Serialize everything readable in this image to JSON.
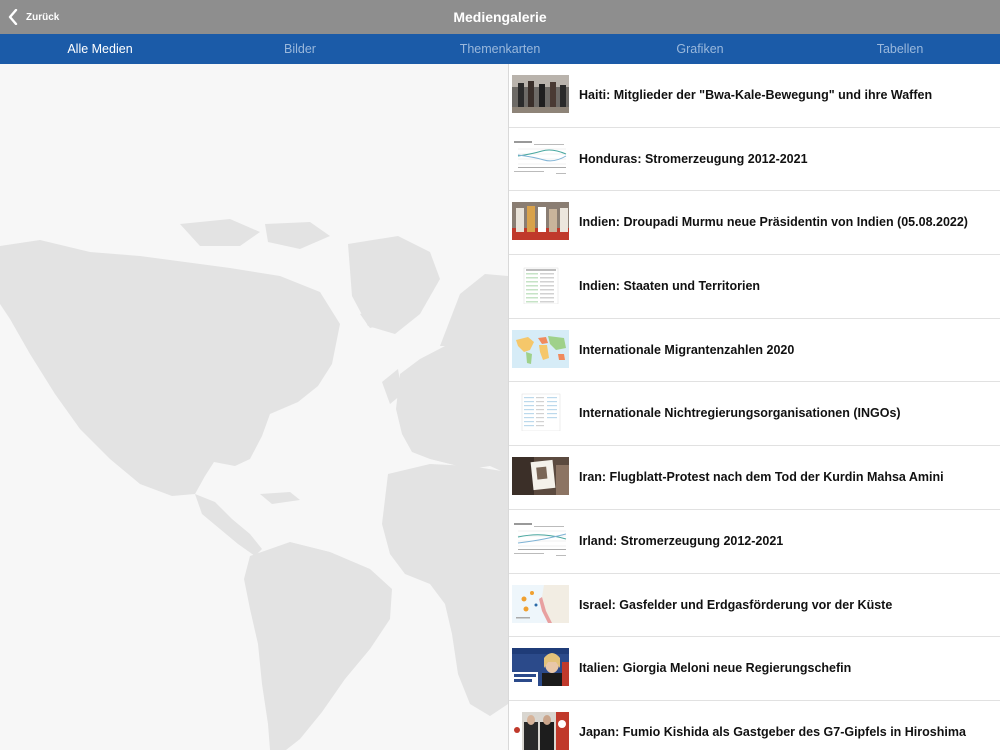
{
  "header": {
    "back_label": "Zurück",
    "title": "Mediengalerie"
  },
  "tabs": [
    {
      "label": "Alle Medien",
      "active": true
    },
    {
      "label": "Bilder",
      "active": false
    },
    {
      "label": "Themenkarten",
      "active": false
    },
    {
      "label": "Grafiken",
      "active": false
    },
    {
      "label": "Tabellen",
      "active": false
    }
  ],
  "colors": {
    "header_bg": "#8e8e8e",
    "tab_bg": "#1b5ba8",
    "tab_active": "#ffffff",
    "tab_inactive": "#9ab8dc",
    "map_land": "#e3e3e3",
    "map_bg": "#f7f7f7"
  },
  "map": {
    "icon": "world-map"
  },
  "media_items": [
    {
      "title": "Haiti: Mitglieder der \"Bwa-Kale-Bewegung\" und ihre Waffen",
      "thumb": "photo"
    },
    {
      "title": "Honduras: Stromerzeugung 2012-2021",
      "thumb": "line-chart"
    },
    {
      "title": "Indien: Droupadi Murmu neue Präsidentin von Indien (05.08.2022)",
      "thumb": "photo"
    },
    {
      "title": "Indien: Staaten und Territorien",
      "thumb": "table"
    },
    {
      "title": "Internationale Migrantenzahlen 2020",
      "thumb": "thematic-map"
    },
    {
      "title": "Internationale Nichtregierungsorganisationen (INGOs)",
      "thumb": "table"
    },
    {
      "title": "Iran: Flugblatt-Protest nach dem Tod der Kurdin Mahsa Amini",
      "thumb": "photo"
    },
    {
      "title": "Irland: Stromerzeugung 2012-2021",
      "thumb": "line-chart"
    },
    {
      "title": "Israel: Gasfelder und Erdgasförderung vor der Küste",
      "thumb": "thematic-map"
    },
    {
      "title": "Italien: Giorgia Meloni neue Regierungschefin",
      "thumb": "photo"
    },
    {
      "title": "Japan: Fumio Kishida als Gastgeber des G7-Gipfels in Hiroshima",
      "thumb": "photo"
    }
  ]
}
